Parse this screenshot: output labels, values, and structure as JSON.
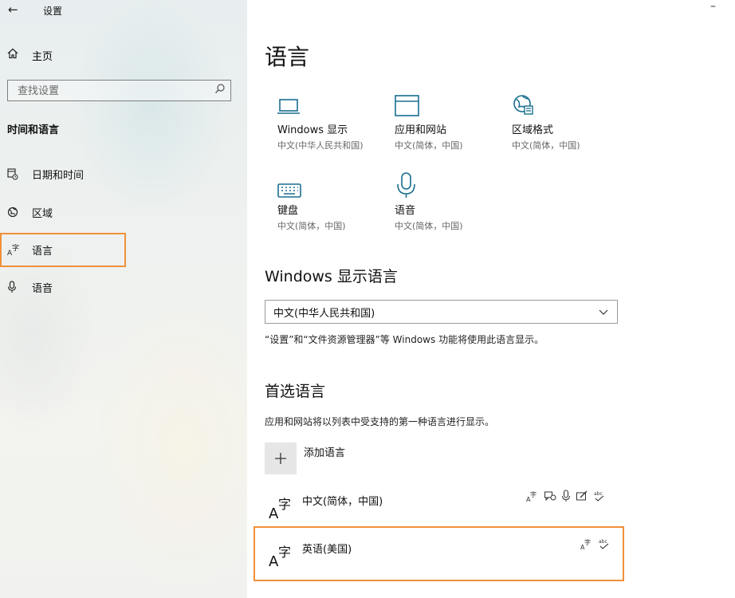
{
  "window": {
    "title": "设置",
    "minimize_symbol": "–"
  },
  "sidebar": {
    "home_label": "主页",
    "search_placeholder": "查找设置",
    "section_title": "时间和语言",
    "items": [
      {
        "label": "日期和时间",
        "icon": "calendar-clock-icon"
      },
      {
        "label": "区域",
        "icon": "globe-icon"
      },
      {
        "label": "语言",
        "icon": "language-icon",
        "selected": true
      },
      {
        "label": "语音",
        "icon": "microphone-icon"
      }
    ]
  },
  "main": {
    "title": "语言",
    "tiles": [
      {
        "name": "Windows 显示",
        "sub": "中文(中华人民共和国)",
        "icon": "monitor-icon"
      },
      {
        "name": "应用和网站",
        "sub": "中文(简体，中国)",
        "icon": "browser-window-icon"
      },
      {
        "name": "区域格式",
        "sub": "中文(简体，中国)",
        "icon": "globe-format-icon"
      },
      {
        "name": "键盘",
        "sub": "中文(简体，中国)",
        "icon": "keyboard-icon"
      },
      {
        "name": "语音",
        "sub": "中文(简体，中国)",
        "icon": "microphone-icon"
      }
    ],
    "display_language": {
      "heading": "Windows 显示语言",
      "selected_value": "中文(中华人民共和国)",
      "note": "“设置”和“文件资源管理器”等 Windows 功能将使用此语言显示。"
    },
    "preferred": {
      "heading": "首选语言",
      "description": "应用和网站将以列表中受支持的第一种语言进行显示。",
      "add_label": "添加语言",
      "languages": [
        {
          "name": "中文(简体，中国)",
          "features": [
            "display-language-icon",
            "speech-bubble-icon",
            "microphone-icon",
            "handwriting-icon",
            "spellcheck-icon"
          ]
        },
        {
          "name": "英语(美国)",
          "features": [
            "display-language-icon",
            "spellcheck-icon"
          ]
        }
      ]
    }
  },
  "colors": {
    "accent": "#1a6e8f",
    "highlight": "#f0903a"
  }
}
